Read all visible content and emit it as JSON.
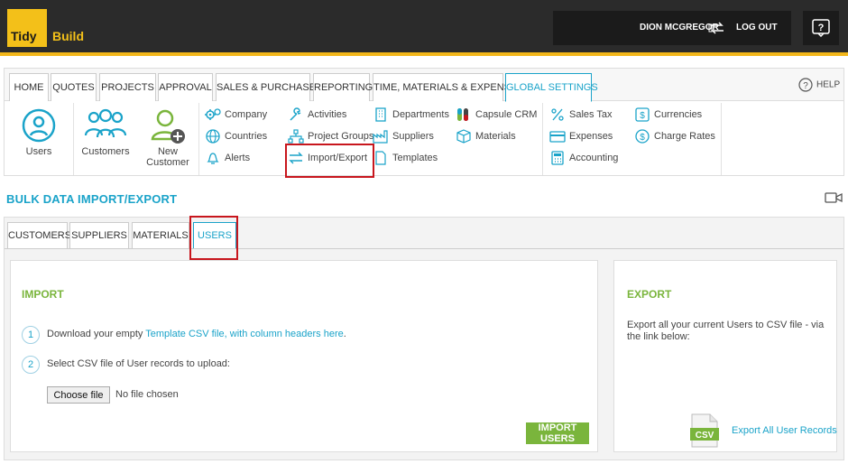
{
  "app": {
    "logo_word1": "Tidy",
    "logo_word2": "Build"
  },
  "header": {
    "username": "DION MCGREGOR",
    "logout_label": "LOG OUT"
  },
  "nav": {
    "tabs": [
      "HOME",
      "QUOTES",
      "PROJECTS",
      "APPROVAL",
      "SALES & PURCHASES",
      "REPORTING",
      "TIME, MATERIALS & EXPENSES",
      "GLOBAL SETTINGS"
    ],
    "active_tab": "GLOBAL SETTINGS",
    "help_label": "HELP"
  },
  "quick_actions": {
    "users": "Users",
    "customers": "Customers",
    "new_customer_1": "New",
    "new_customer_2": "Customer"
  },
  "settings_menu": {
    "company": "Company",
    "countries": "Countries",
    "alerts": "Alerts",
    "activities": "Activities",
    "project_groups": "Project Groups",
    "import_export": "Import/Export",
    "departments": "Departments",
    "suppliers": "Suppliers",
    "templates": "Templates",
    "capsule_crm": "Capsule CRM",
    "materials": "Materials",
    "sales_tax": "Sales Tax",
    "expenses": "Expenses",
    "accounting": "Accounting",
    "currencies": "Currencies",
    "charge_rates": "Charge Rates"
  },
  "page": {
    "title": "BULK DATA IMPORT/EXPORT"
  },
  "bulk_tabs": [
    "CUSTOMERS",
    "SUPPLIERS",
    "MATERIALS",
    "USERS"
  ],
  "active_bulk_tab": "USERS",
  "import": {
    "heading": "IMPORT",
    "step1_num": "1",
    "step1_prefix": "Download your empty ",
    "step1_link": "Template CSV file, with column headers here",
    "step1_suffix": ".",
    "step2_num": "2",
    "step2_text": "Select CSV file of User records to upload:",
    "file_button": "Choose file",
    "file_status": "No file chosen",
    "submit_button": "IMPORT USERS"
  },
  "export": {
    "heading": "EXPORT",
    "description": "Export all your current Users to CSV file - via the link below:",
    "csv_label": "CSV",
    "link": "Export All User Records"
  },
  "colors": {
    "accent": "#1aa3c9",
    "green": "#7ab53c",
    "brand_yellow": "#f3c019",
    "highlight": "#c8161d"
  }
}
